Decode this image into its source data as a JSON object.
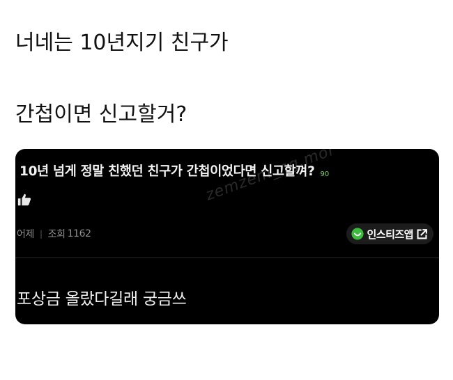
{
  "heading": {
    "line1": "너네는 10년지기 친구가",
    "line2": "간첩이면 신고할거?"
  },
  "post": {
    "title": "10년 넘게 정말 친했던 친구가 간첩이었다면 신고할껴?",
    "comment_count": "90",
    "meta": {
      "date": "어제",
      "separator": "|",
      "views_label": "조회",
      "views": "1162"
    },
    "app_button_label": "인스티즈앱",
    "comment": "포상금 올랐다길래 궁금쓰",
    "watermark": "zemzem_ng.mor"
  },
  "icons": {
    "like": "thumbs-up-icon",
    "app_logo": "instiz-logo-icon",
    "external": "external-link-icon"
  },
  "colors": {
    "card_background": "#000000",
    "app_logo_green": "#3dbb3f",
    "comment_count_green": "#7fd36b"
  }
}
